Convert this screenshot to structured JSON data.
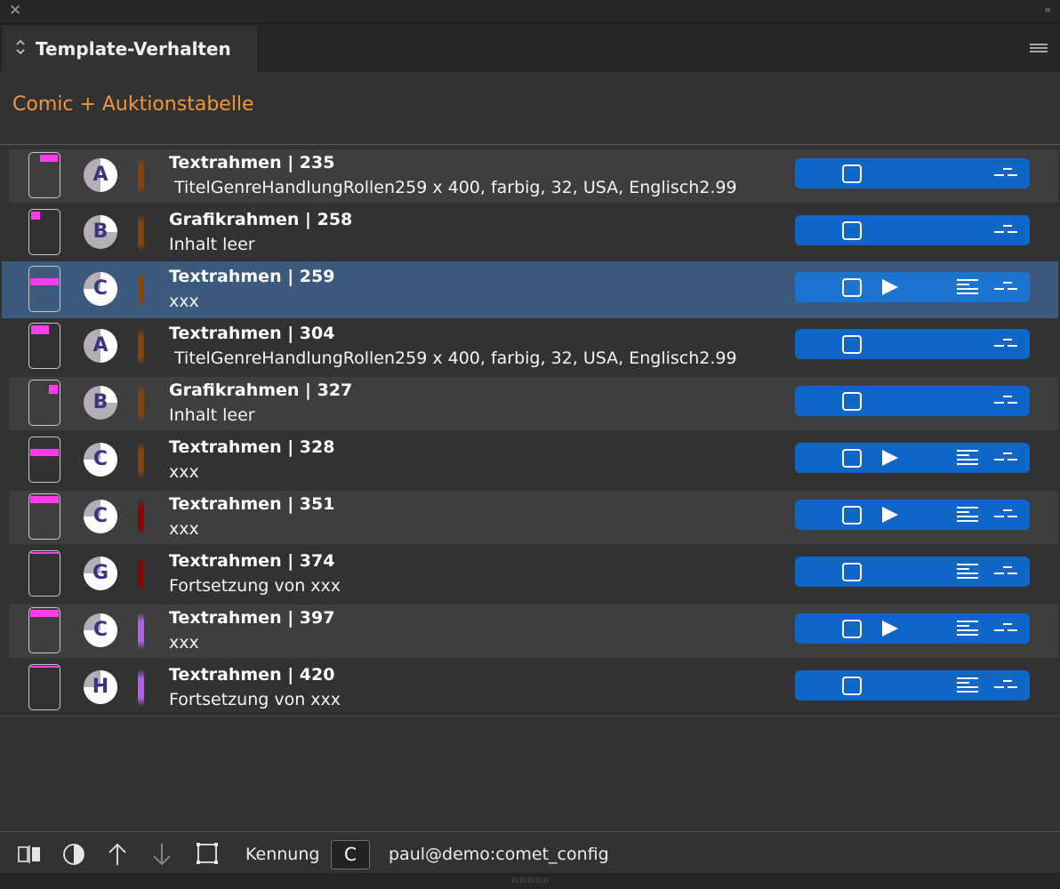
{
  "window": {
    "close_icon": "close-icon",
    "collapse_icon": "collapse-icon",
    "collapse_glyph": "‹‹"
  },
  "panel": {
    "tab_title": "Template-Verhalten",
    "tab_glyph": "⌃⌄",
    "menu_icon": "panel-menu-icon"
  },
  "heading": "Comic + Auktionstabelle",
  "rows": [
    {
      "title": "Textrahmen | 235",
      "subtitle": " TitelGenreHandlungRollen259 x 400, farbig, 32, USA, Englisch2.99",
      "letter": "A",
      "fill_deg": 180,
      "bar_color": "#8a4506",
      "alt": true,
      "selected": false,
      "play": false,
      "lines": false,
      "marker": {
        "l": 12,
        "t": 2,
        "w": 20,
        "h": 8
      }
    },
    {
      "title": "Grafikrahmen | 258",
      "subtitle": "Inhalt leer",
      "letter": "B",
      "fill_deg": 90,
      "bar_color": "#8a4506",
      "alt": false,
      "selected": false,
      "play": false,
      "lines": false,
      "marker": {
        "l": 2,
        "t": 2,
        "w": 10,
        "h": 9
      }
    },
    {
      "title": "Textrahmen | 259",
      "subtitle": "xxx",
      "letter": "C",
      "fill_deg": 270,
      "bar_color": "#8a4506",
      "alt": false,
      "selected": true,
      "play": true,
      "lines": true,
      "marker": {
        "l": 1,
        "t": 13,
        "w": 32,
        "h": 8
      }
    },
    {
      "title": "Textrahmen | 304",
      "subtitle": " TitelGenreHandlungRollen259 x 400, farbig, 32, USA, Englisch2.99",
      "letter": "A",
      "fill_deg": 180,
      "bar_color": "#8a4506",
      "alt": false,
      "selected": false,
      "play": false,
      "lines": false,
      "marker": {
        "l": 2,
        "t": 2,
        "w": 20,
        "h": 10
      }
    },
    {
      "title": "Grafikrahmen | 327",
      "subtitle": "Inhalt leer",
      "letter": "B",
      "fill_deg": 90,
      "bar_color": "#8a4506",
      "alt": true,
      "selected": false,
      "play": false,
      "lines": false,
      "marker": {
        "l": 22,
        "t": 5,
        "w": 10,
        "h": 10
      }
    },
    {
      "title": "Textrahmen | 328",
      "subtitle": "xxx",
      "letter": "C",
      "fill_deg": 270,
      "bar_color": "#8a4506",
      "alt": false,
      "selected": false,
      "play": true,
      "lines": true,
      "marker": {
        "l": 1,
        "t": 13,
        "w": 32,
        "h": 8
      }
    },
    {
      "title": "Textrahmen | 351",
      "subtitle": "xxx",
      "letter": "C",
      "fill_deg": 270,
      "bar_color": "#8a0404",
      "alt": true,
      "selected": false,
      "play": true,
      "lines": true,
      "marker": {
        "l": 1,
        "t": 2,
        "w": 32,
        "h": 8
      }
    },
    {
      "title": "Textrahmen | 374",
      "subtitle": "Fortsetzung von xxx",
      "letter": "G",
      "fill_deg": 270,
      "bar_color": "#8a0404",
      "alt": false,
      "selected": false,
      "play": false,
      "lines": true,
      "marker": {
        "l": 1,
        "t": 1,
        "w": 32,
        "h": 2
      }
    },
    {
      "title": "Textrahmen | 397",
      "subtitle": "xxx",
      "letter": "C",
      "fill_deg": 270,
      "bar_color": "#b45ef0",
      "alt": true,
      "selected": false,
      "play": true,
      "lines": true,
      "marker": {
        "l": 1,
        "t": 2,
        "w": 32,
        "h": 8
      }
    },
    {
      "title": "Textrahmen | 420",
      "subtitle": "Fortsetzung von xxx",
      "letter": "H",
      "fill_deg": 270,
      "bar_color": "#b45ef0",
      "alt": false,
      "selected": false,
      "play": false,
      "lines": true,
      "marker": {
        "l": 1,
        "t": 1,
        "w": 32,
        "h": 2
      }
    }
  ],
  "footer": {
    "icons": [
      "split-view-icon",
      "pie-chart-icon",
      "arrow-up-icon",
      "arrow-down-icon",
      "frame-select-icon"
    ],
    "ident_label": "Kennung",
    "ident_value": "C",
    "user": "paul@demo:comet_config"
  },
  "colors": {
    "accent": "#f0953a",
    "action_blue": "#0e67c8",
    "marker_pink": "#ff3cf0",
    "selected_row": "#3c5a7e"
  }
}
